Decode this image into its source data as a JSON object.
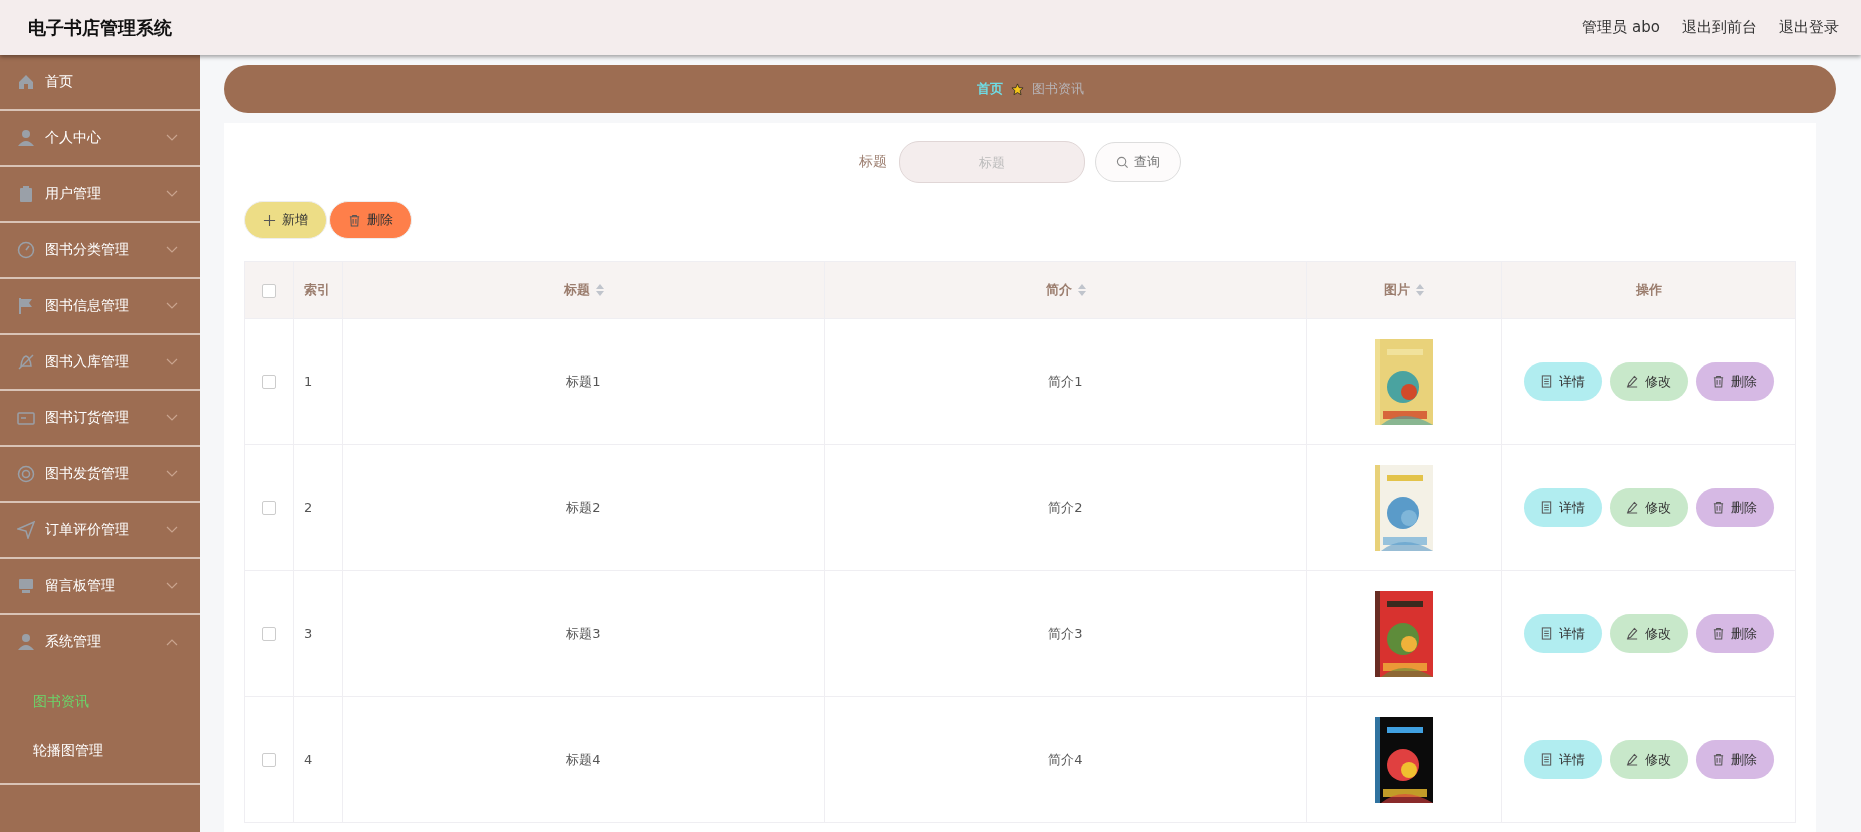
{
  "header": {
    "title": "电子书店管理系统",
    "links": [
      "管理员 abo",
      "退出到前台",
      "退出登录"
    ]
  },
  "sidebar": {
    "items": [
      {
        "label": "首页"
      },
      {
        "label": "个人中心",
        "expanded": false
      },
      {
        "label": "用户管理",
        "expanded": false
      },
      {
        "label": "图书分类管理",
        "expanded": false
      },
      {
        "label": "图书信息管理",
        "expanded": false
      },
      {
        "label": "图书入库管理",
        "expanded": false
      },
      {
        "label": "图书订货管理",
        "expanded": false
      },
      {
        "label": "图书发货管理",
        "expanded": false
      },
      {
        "label": "订单评价管理",
        "expanded": false
      },
      {
        "label": "留言板管理",
        "expanded": false
      },
      {
        "label": "系统管理",
        "expanded": true,
        "children": [
          {
            "label": "图书资讯",
            "selected": true
          },
          {
            "label": "轮播图管理",
            "selected": false
          }
        ]
      }
    ]
  },
  "breadcrumb": [
    {
      "label": "首页",
      "current": false
    },
    {
      "label": "图书资讯",
      "current": true
    }
  ],
  "search": {
    "label": "标题",
    "placeholder": "标题",
    "button": "查询"
  },
  "toolbar": [
    {
      "label": "新增",
      "kind": "add"
    },
    {
      "label": "删除",
      "kind": "delete"
    }
  ],
  "table": {
    "select_all": {
      "checked": false
    },
    "columns": [
      {
        "label": "索引",
        "sortable": false
      },
      {
        "label": "标题",
        "sortable": true
      },
      {
        "label": "简介",
        "sortable": true
      },
      {
        "label": "图片",
        "sortable": true
      },
      {
        "label": "操作",
        "sortable": false
      }
    ],
    "rows": [
      {
        "checked": false,
        "index": "1",
        "title": "标题1",
        "intro": "简介1",
        "picture": {
          "kind": "picture"
        },
        "actions": [
          {
            "label": "详情",
            "kind": "detail"
          },
          {
            "label": "修改",
            "kind": "edit"
          },
          {
            "label": "删除",
            "kind": "delete"
          }
        ]
      },
      {
        "checked": false,
        "index": "2",
        "title": "标题2",
        "intro": "简介2",
        "picture": {
          "kind": "picture"
        },
        "actions": [
          {
            "label": "详情",
            "kind": "detail"
          },
          {
            "label": "修改",
            "kind": "edit"
          },
          {
            "label": "删除",
            "kind": "delete"
          }
        ]
      },
      {
        "checked": false,
        "index": "3",
        "title": "标题3",
        "intro": "简介3",
        "picture": {
          "kind": "picture"
        },
        "actions": [
          {
            "label": "详情",
            "kind": "detail"
          },
          {
            "label": "修改",
            "kind": "edit"
          },
          {
            "label": "删除",
            "kind": "delete"
          }
        ]
      },
      {
        "checked": false,
        "index": "4",
        "title": "标题4",
        "intro": "简介4",
        "picture": {
          "kind": "picture"
        },
        "actions": [
          {
            "label": "详情",
            "kind": "detail"
          },
          {
            "label": "修改",
            "kind": "edit"
          },
          {
            "label": "删除",
            "kind": "delete"
          }
        ]
      }
    ]
  }
}
